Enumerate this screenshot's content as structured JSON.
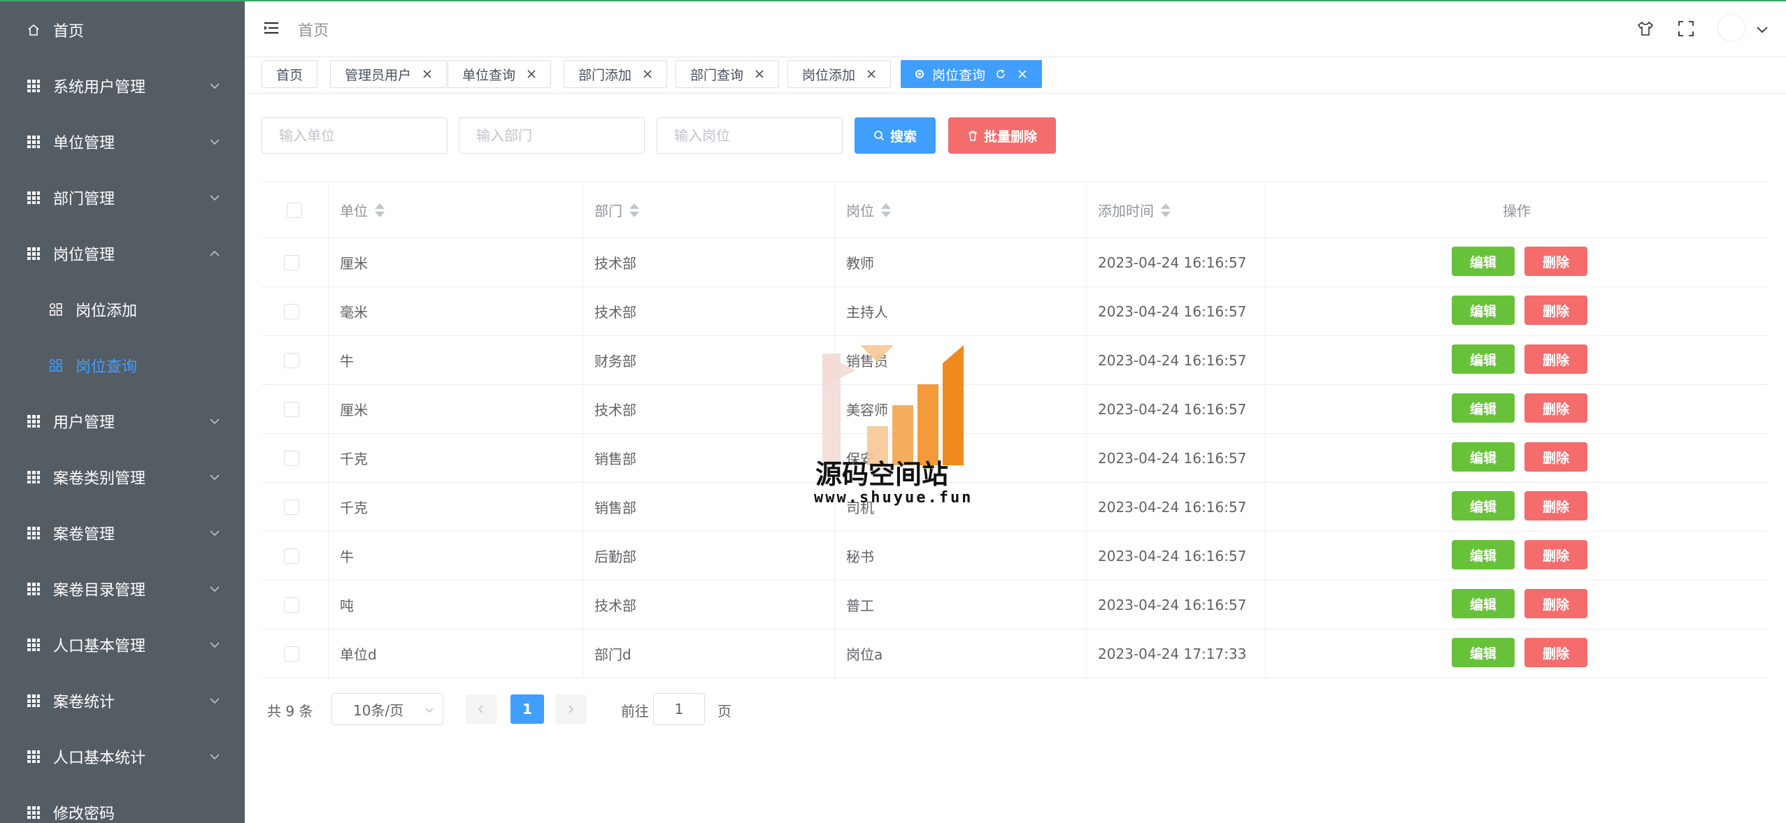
{
  "sidebar": {
    "items": [
      {
        "label": "首页",
        "icon": "home-icon",
        "has_arrow": false
      },
      {
        "label": "系统用户管理",
        "icon": "grid-icon",
        "has_arrow": true
      },
      {
        "label": "单位管理",
        "icon": "grid-icon",
        "has_arrow": true
      },
      {
        "label": "部门管理",
        "icon": "grid-icon",
        "has_arrow": true
      },
      {
        "label": "岗位管理",
        "icon": "grid-icon",
        "has_arrow": true,
        "expanded": true
      },
      {
        "label": "岗位添加",
        "icon": "apps-icon",
        "sub": true
      },
      {
        "label": "岗位查询",
        "icon": "apps-icon",
        "sub": true,
        "active": true
      },
      {
        "label": "用户管理",
        "icon": "grid-icon",
        "has_arrow": true
      },
      {
        "label": "案卷类别管理",
        "icon": "grid-icon",
        "has_arrow": true
      },
      {
        "label": "案卷管理",
        "icon": "grid-icon",
        "has_arrow": true
      },
      {
        "label": "案卷目录管理",
        "icon": "grid-icon",
        "has_arrow": true
      },
      {
        "label": "人口基本管理",
        "icon": "grid-icon",
        "has_arrow": true
      },
      {
        "label": "案卷统计",
        "icon": "grid-icon",
        "has_arrow": true
      },
      {
        "label": "人口基本统计",
        "icon": "grid-icon",
        "has_arrow": true
      },
      {
        "label": "修改密码",
        "icon": "grid-icon",
        "has_arrow": false
      }
    ]
  },
  "header": {
    "title": "首页"
  },
  "tabs": [
    {
      "label": "首页",
      "closable": false
    },
    {
      "label": "管理员用户",
      "closable": true
    },
    {
      "label": "单位查询",
      "closable": true
    },
    {
      "label": "部门添加",
      "closable": true
    },
    {
      "label": "部门查询",
      "closable": true
    },
    {
      "label": "岗位添加",
      "closable": true
    },
    {
      "label": "岗位查询",
      "closable": true,
      "active": true
    }
  ],
  "search": {
    "unit_placeholder": "输入单位",
    "dept_placeholder": "输入部门",
    "post_placeholder": "输入岗位",
    "search_label": "搜索",
    "batch_delete_label": "批量删除"
  },
  "table": {
    "headers": {
      "unit": "单位",
      "dept": "部门",
      "post": "岗位",
      "time": "添加时间",
      "ops": "操作"
    },
    "edit_label": "编辑",
    "delete_label": "删除",
    "rows": [
      {
        "unit": "厘米",
        "dept": "技术部",
        "post": "教师",
        "time": "2023-04-24 16:16:57"
      },
      {
        "unit": "毫米",
        "dept": "技术部",
        "post": "主持人",
        "time": "2023-04-24 16:16:57"
      },
      {
        "unit": "牛",
        "dept": "财务部",
        "post": "销售员",
        "time": "2023-04-24 16:16:57"
      },
      {
        "unit": "厘米",
        "dept": "技术部",
        "post": "美容师",
        "time": "2023-04-24 16:16:57"
      },
      {
        "unit": "千克",
        "dept": "销售部",
        "post": "保安",
        "time": "2023-04-24 16:16:57"
      },
      {
        "unit": "千克",
        "dept": "销售部",
        "post": "司机",
        "time": "2023-04-24 16:16:57"
      },
      {
        "unit": "牛",
        "dept": "后勤部",
        "post": "秘书",
        "time": "2023-04-24 16:16:57"
      },
      {
        "unit": "吨",
        "dept": "技术部",
        "post": "普工",
        "time": "2023-04-24 16:16:57"
      },
      {
        "unit": "单位d",
        "dept": "部门d",
        "post": "岗位a",
        "time": "2023-04-24 17:17:33"
      }
    ]
  },
  "pagination": {
    "total_text": "共 9 条",
    "page_size": "10条/页",
    "current_page": "1",
    "goto_label": "前往",
    "goto_value": "1",
    "page_suffix": "页"
  },
  "watermark": {
    "title": "源码空间站",
    "url": "www.shuyue.fun"
  },
  "colors": {
    "sidebar_bg": "#545c64",
    "primary": "#409eff",
    "danger": "#f56c6c",
    "success": "#67c23a"
  }
}
